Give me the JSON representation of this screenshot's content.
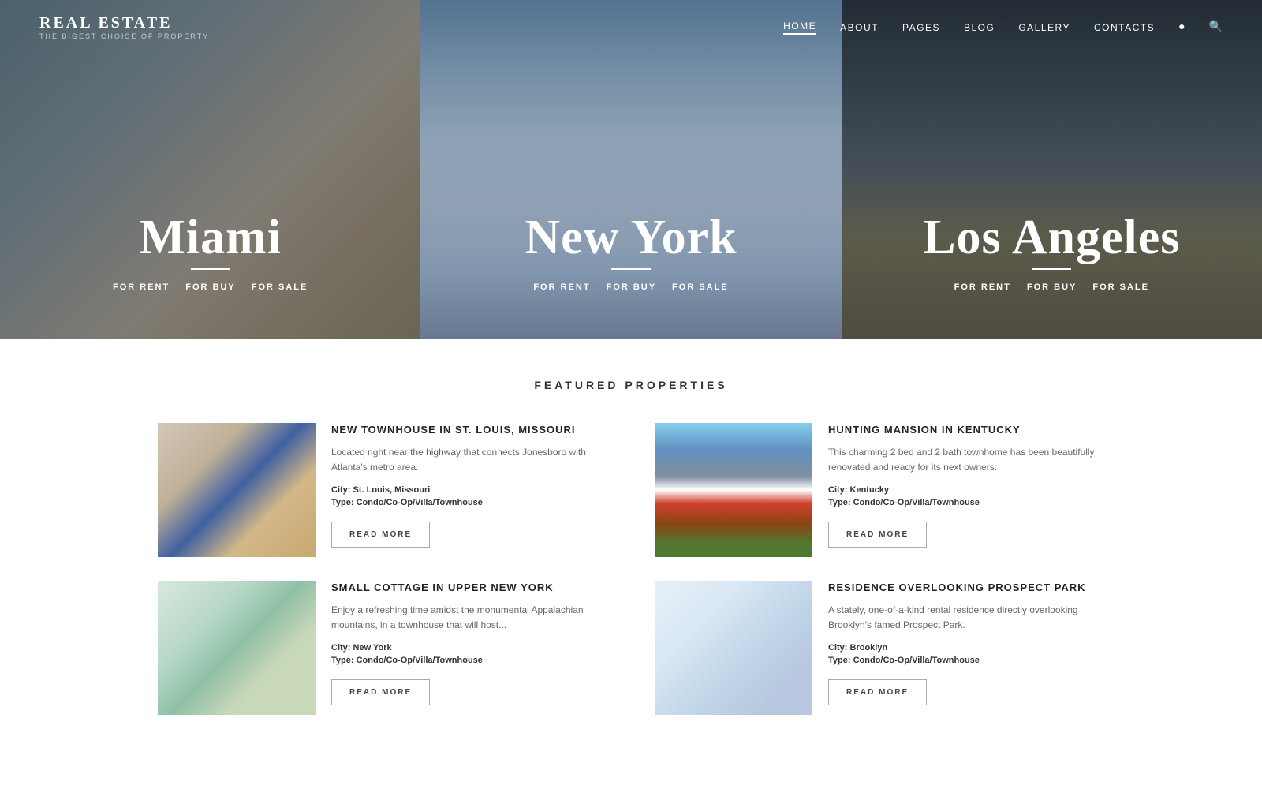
{
  "header": {
    "logo_title": "REAL ESTATE",
    "logo_subtitle": "THE BIGEST CHOISE OF PROPERTY",
    "nav_items": [
      {
        "label": "HOME",
        "active": true
      },
      {
        "label": "ABOUT",
        "active": false
      },
      {
        "label": "PAGES",
        "active": false
      },
      {
        "label": "BLOG",
        "active": false
      },
      {
        "label": "GALLERY",
        "active": false
      },
      {
        "label": "CONTACTS",
        "active": false
      }
    ]
  },
  "hero": {
    "panels": [
      {
        "city": "Miami",
        "links": [
          "FOR RENT",
          "FOR BUY",
          "FOR SALE"
        ],
        "class": "left"
      },
      {
        "city": "New York",
        "links": [
          "FOR RENT",
          "FOR BUY",
          "FOR SALE"
        ],
        "class": "center"
      },
      {
        "city": "Los Angeles",
        "links": [
          "FOR RENT",
          "FOR BUY",
          "FOR SALE"
        ],
        "class": "right"
      }
    ]
  },
  "featured": {
    "section_title": "FEATURED PROPERTIES",
    "properties": [
      {
        "title": "NEW TOWNHOUSE IN ST. LOUIS, MISSOURI",
        "description": "Located right near the highway that connects Jonesboro with Atlanta's metro area.",
        "city": "St. Louis, Missouri",
        "type": "Condo/Co-Op/Villa/Townhouse",
        "read_more": "READ MORE",
        "img_class": "prop-img-1"
      },
      {
        "title": "HUNTING MANSION IN KENTUCKY",
        "description": "This charming 2 bed and 2 bath townhome has been beautifully renovated and ready for its next owners.",
        "city": "Kentucky",
        "type": "Condo/Co-Op/Villa/Townhouse",
        "read_more": "READ MORE",
        "img_class": "prop-img-2"
      },
      {
        "title": "SMALL COTTAGE IN UPPER NEW YORK",
        "description": "Enjoy a refreshing time amidst the monumental Appalachian mountains, in a townhouse that will host...",
        "city": "New York",
        "type": "Condo/Co-Op/Villa/Townhouse",
        "read_more": "READ MORE",
        "img_class": "prop-img-3"
      },
      {
        "title": "RESIDENCE OVERLOOKING PROSPECT PARK",
        "description": "A stately, one-of-a-kind rental residence directly overlooking Brooklyn's famed Prospect Park.",
        "city": "Brooklyn",
        "type": "Condo/Co-Op/Villa/Townhouse",
        "read_more": "READ MORE",
        "img_class": "prop-img-4"
      }
    ]
  }
}
